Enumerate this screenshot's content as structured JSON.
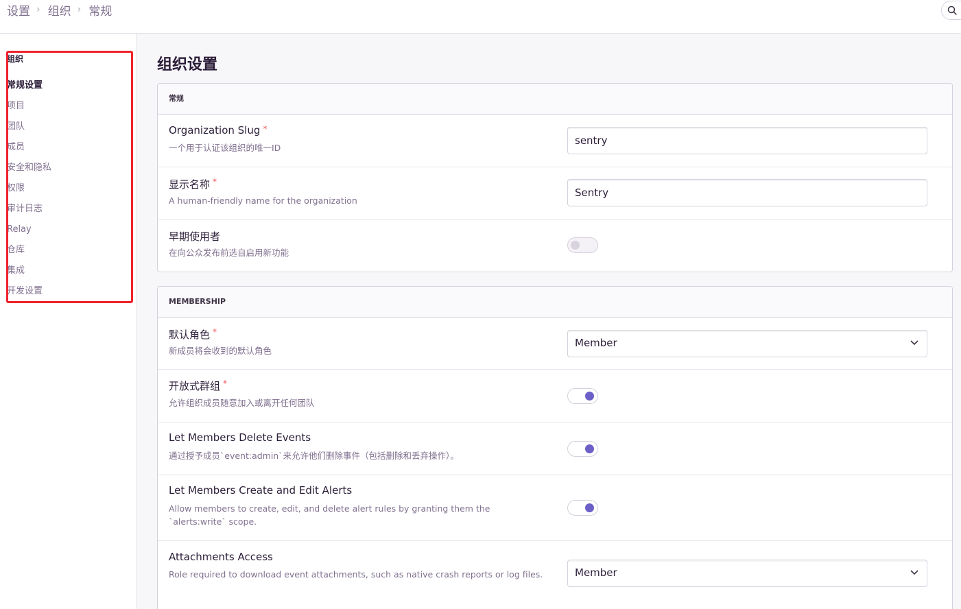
{
  "breadcrumb": [
    "设置",
    "组织",
    "常规"
  ],
  "sidebar": {
    "heading": "组织",
    "items": [
      {
        "label": "常规设置",
        "active": true
      },
      {
        "label": "项目"
      },
      {
        "label": "团队"
      },
      {
        "label": "成员"
      },
      {
        "label": "安全和隐私"
      },
      {
        "label": "权限"
      },
      {
        "label": "审计日志"
      },
      {
        "label": "Relay"
      },
      {
        "label": "仓库"
      },
      {
        "label": "集成"
      },
      {
        "label": "开发设置"
      }
    ]
  },
  "main": {
    "title": "组织设置",
    "general": {
      "header": "常规",
      "slug": {
        "label": "Organization Slug",
        "required": "*",
        "help": "一个用于认证该组织的唯一ID",
        "value": "sentry"
      },
      "name": {
        "label": "显示名称",
        "required": "*",
        "help": "A human-friendly name for the organization",
        "value": "Sentry"
      },
      "early": {
        "label": "早期使用者",
        "help": "在向公众发布前选自启用新功能",
        "enabled": false
      }
    },
    "membership": {
      "header": "MEMBERSHIP",
      "default_role": {
        "label": "默认角色",
        "required": "*",
        "help": "新成员将会收到的默认角色",
        "value": "Member"
      },
      "open_membership": {
        "label": "开放式群组",
        "required": "*",
        "help": "允许组织成员随意加入或离开任何团队",
        "enabled": true
      },
      "delete_events": {
        "label": "Let Members Delete Events",
        "help": "通过授予成员`event:admin`来允许他们删除事件（包括删除和丢弃操作）。",
        "enabled": true
      },
      "alerts": {
        "label": "Let Members Create and Edit Alerts",
        "help": "Allow members to create, edit, and delete alert rules by granting them the `alerts:write` scope.",
        "enabled": true
      },
      "attachments": {
        "label": "Attachments Access",
        "help": "Role required to download event attachments, such as native crash reports or log files.",
        "value": "Member"
      }
    }
  },
  "colors": {
    "accent": "#6c5fc7",
    "required": "#f55459",
    "highlight": "#f0222c"
  }
}
